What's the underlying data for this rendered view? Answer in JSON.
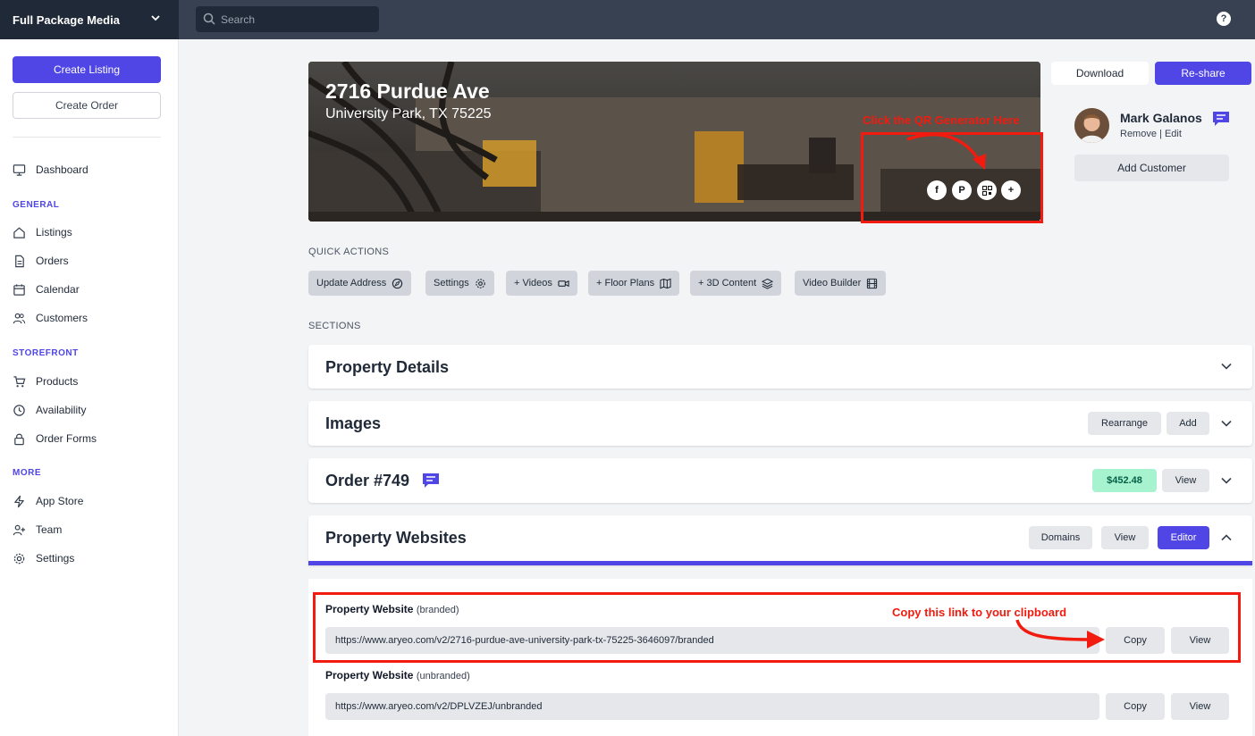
{
  "topbar": {
    "org_name": "Full Package Media",
    "search_placeholder": "Search",
    "help_label": "?"
  },
  "sidebar": {
    "create_listing": "Create Listing",
    "create_order": "Create Order",
    "dashboard": "Dashboard",
    "sections": [
      {
        "heading": "GENERAL",
        "items": [
          "Listings",
          "Orders",
          "Calendar",
          "Customers"
        ]
      },
      {
        "heading": "STOREFRONT",
        "items": [
          "Products",
          "Availability",
          "Order Forms"
        ]
      },
      {
        "heading": "MORE",
        "items": [
          "App Store",
          "Team",
          "Settings"
        ]
      }
    ]
  },
  "listing": {
    "address": "2716 Purdue Ave",
    "city_line": "University Park, TX 75225",
    "share_icons": [
      "facebook-icon",
      "pinterest-icon",
      "qr-code-icon",
      "plus-icon"
    ]
  },
  "annotations": {
    "qr_note": "Click the QR Generator Here",
    "copy_note": "Copy this link to your clipboard",
    "color": "#f21b0f"
  },
  "actions": {
    "download": "Download",
    "reshare": "Re-share"
  },
  "customer": {
    "name": "Mark Galanos",
    "remove": "Remove",
    "separator": "|",
    "edit": "Edit",
    "add_customer": "Add Customer"
  },
  "quick_actions": {
    "heading": "QUICK ACTIONS",
    "items": [
      "Update Address",
      "Settings",
      "+ Videos",
      "+ Floor Plans",
      "+ 3D Content",
      "Video Builder"
    ]
  },
  "sections": {
    "heading": "SECTIONS",
    "property_details": "Property Details",
    "images": {
      "title": "Images",
      "rearrange": "Rearrange",
      "add": "Add"
    },
    "order": {
      "title": "Order #749",
      "price": "$452.48",
      "view": "View"
    },
    "websites": {
      "title": "Property Websites",
      "domains": "Domains",
      "view": "View",
      "editor": "Editor"
    }
  },
  "websites": {
    "branded": {
      "label": "Property Website",
      "tag": "(branded)",
      "url": "https://www.aryeo.com/v2/2716-purdue-ave-university-park-tx-75225-3646097/branded",
      "copy": "Copy",
      "view": "View"
    },
    "unbranded": {
      "label": "Property Website",
      "tag": "(unbranded)",
      "url": "https://www.aryeo.com/v2/DPLVZEJ/unbranded",
      "copy": "Copy",
      "view": "View"
    }
  },
  "colors": {
    "accent": "#4f46e5",
    "topbar": "#374151",
    "brand_bg": "#1f2937",
    "price_badge": "#a7f3d0"
  }
}
